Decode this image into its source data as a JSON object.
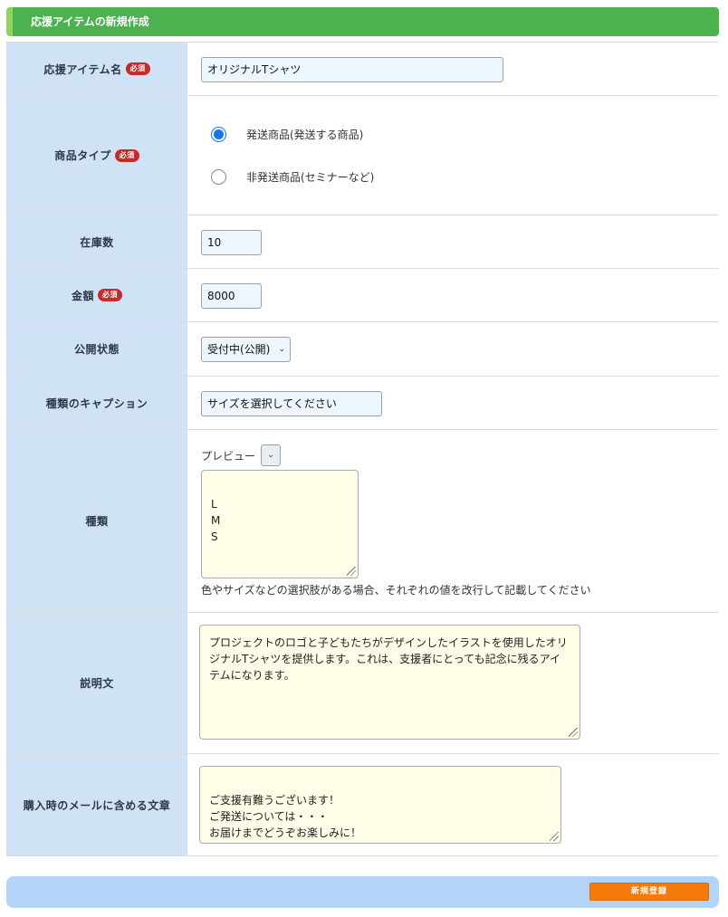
{
  "header": {
    "title": "応援アイテムの新規作成"
  },
  "required_badge": "必須",
  "fields": {
    "item_name": {
      "label": "応援アイテム名",
      "value": "オリジナルTシャツ"
    },
    "product_type": {
      "label": "商品タイプ",
      "options": [
        {
          "label": "発送商品(発送する商品)",
          "checked": true
        },
        {
          "label": "非発送商品(セミナーなど)",
          "checked": false
        }
      ]
    },
    "stock": {
      "label": "在庫数",
      "value": "10"
    },
    "price": {
      "label": "金額",
      "value": "8000"
    },
    "status": {
      "label": "公開状態",
      "selected": "受付中(公開)"
    },
    "variant_caption": {
      "label": "種類のキャプション",
      "value": "サイズを選択してください"
    },
    "variants": {
      "label": "種類",
      "preview_label": "プレビュー",
      "value": "L\nM\nS",
      "hint": "色やサイズなどの選択肢がある場合、それぞれの値を改行して記載してください"
    },
    "description": {
      "label": "説明文",
      "value": "プロジェクトのロゴと子どもたちがデザインしたイラストを使用したオリジナルTシャツを提供します。これは、支援者にとっても記念に残るアイテムになります。"
    },
    "purchase_mail": {
      "label": "購入時のメールに含める文章",
      "value": "ご支援有難うございます！\nご発送については・・・\nお届けまでどうぞお楽しみに！"
    }
  },
  "footer": {
    "submit_label": "新規登録"
  }
}
